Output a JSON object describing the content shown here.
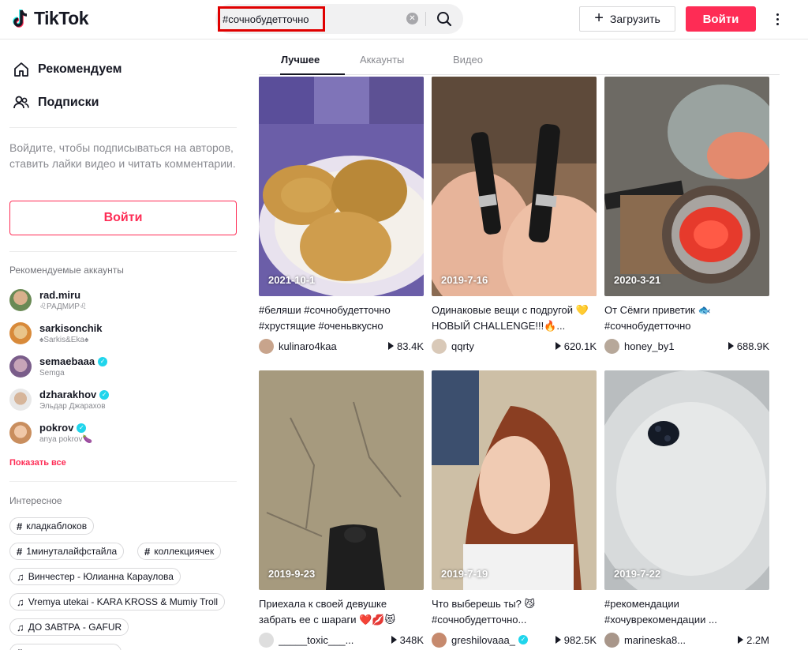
{
  "header": {
    "logo_text": "TikTok",
    "search_value": "#сочнобудетточно",
    "upload_label": "Загрузить",
    "login_label": "Войти"
  },
  "sidebar": {
    "nav": [
      {
        "label": "Рекомендуем",
        "icon": "home-icon"
      },
      {
        "label": "Подписки",
        "icon": "following-icon"
      }
    ],
    "login_prompt": "Войдите, чтобы подписываться на авторов, ставить лайки видео и читать комментарии.",
    "login_button": "Войти",
    "recommended_title": "Рекомендуемые аккаунты",
    "accounts": [
      {
        "name": "rad.miru",
        "sub": "♌РАДМИР♌",
        "verified": false
      },
      {
        "name": "sarkisonchik",
        "sub": "♠Sarkis&Eka♠",
        "verified": false
      },
      {
        "name": "semaebaaa",
        "sub": "Semga",
        "verified": true
      },
      {
        "name": "dzharakhov",
        "sub": "Эльдар Джарахов",
        "verified": true
      },
      {
        "name": "pokrov",
        "sub": "anya pokrov🍆",
        "verified": true
      }
    ],
    "show_all": "Показать все",
    "discover_title": "Интересное",
    "tags": [
      {
        "type": "hashtag",
        "label": "кладкаблоков"
      },
      {
        "type": "hashtag",
        "label": "1минуталайфстайла"
      },
      {
        "type": "hashtag",
        "label": "коллекциячек"
      },
      {
        "type": "music",
        "label": "Винчестер - Юлианна Караулова"
      },
      {
        "type": "music",
        "label": "Vremya utekai - KARA KROSS & Mumiy Troll"
      },
      {
        "type": "music",
        "label": "ДО ЗАВТРА - GAFUR"
      }
    ]
  },
  "tabs": [
    {
      "label": "Лучшее",
      "active": true
    },
    {
      "label": "Аккаунты",
      "active": false
    },
    {
      "label": "Видео",
      "active": false
    }
  ],
  "videos": [
    {
      "date": "2021-10-1",
      "desc": "#беляши #сочнобудетточно #хрустящие #оченьвкусно",
      "user": "kulinaro4kaa",
      "plays": "83.4K",
      "verified": false
    },
    {
      "date": "2019-7-16",
      "desc": "Одинаковые вещи с подругой 💛 НОВЫЙ CHALLENGE!!!🔥...",
      "user": "qqrty",
      "plays": "620.1K",
      "verified": false
    },
    {
      "date": "2020-3-21",
      "desc": "От Сёмги приветик 🐟 #сочнобудетточно",
      "user": "honey_by1",
      "plays": "688.9K",
      "verified": false
    },
    {
      "date": "2019-9-23",
      "desc": "Приехала к своей девушке забрать ее с шараги ❤️💋😻",
      "user": "_____toxic___...",
      "plays": "348K",
      "verified": false
    },
    {
      "date": "2019-7-19",
      "desc": "Что выберешь ты? 😼 #сочнобудетточно...",
      "user": "greshilovaaa_",
      "plays": "982.5K",
      "verified": true
    },
    {
      "date": "2019-7-22",
      "desc": "#рекомендации #хочуврекомендации ...",
      "user": "marineska8...",
      "plays": "2.2M",
      "verified": false
    }
  ],
  "colors": {
    "brand": "#fe2c55",
    "verified": "#20d5ec",
    "search_highlight": "#e00000"
  }
}
